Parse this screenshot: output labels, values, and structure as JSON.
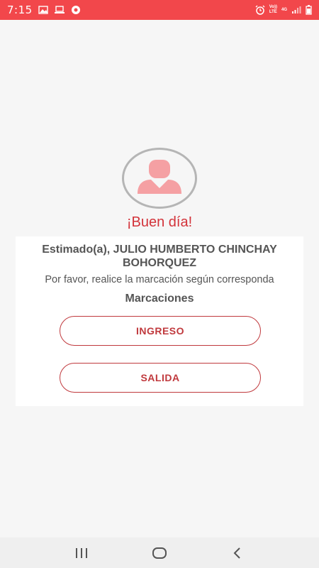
{
  "status_bar": {
    "time": "7:15",
    "volte_label": "Vo))\nLTE",
    "network_label": "4G",
    "icons": [
      "image-icon",
      "laptop-icon",
      "chrome-icon",
      "alarm-icon",
      "volte-icon",
      "signal-icon",
      "battery-icon"
    ]
  },
  "greeting": "¡Buen día!",
  "card": {
    "name_line": "Estimado(a), JULIO HUMBERTO CHINCHAY BOHORQUEZ",
    "message": "Por favor, realice la marcación según corresponda",
    "section_title": "Marcaciones",
    "buttons": {
      "ingreso_label": "INGRESO",
      "salida_label": "SALIDA"
    }
  },
  "nav_bar": {
    "icons": [
      "recent-apps-icon",
      "home-icon",
      "back-icon"
    ]
  },
  "colors": {
    "status_bar": "#f2474b",
    "accent": "#c0393d",
    "avatar_fill": "#f5a0a3"
  }
}
